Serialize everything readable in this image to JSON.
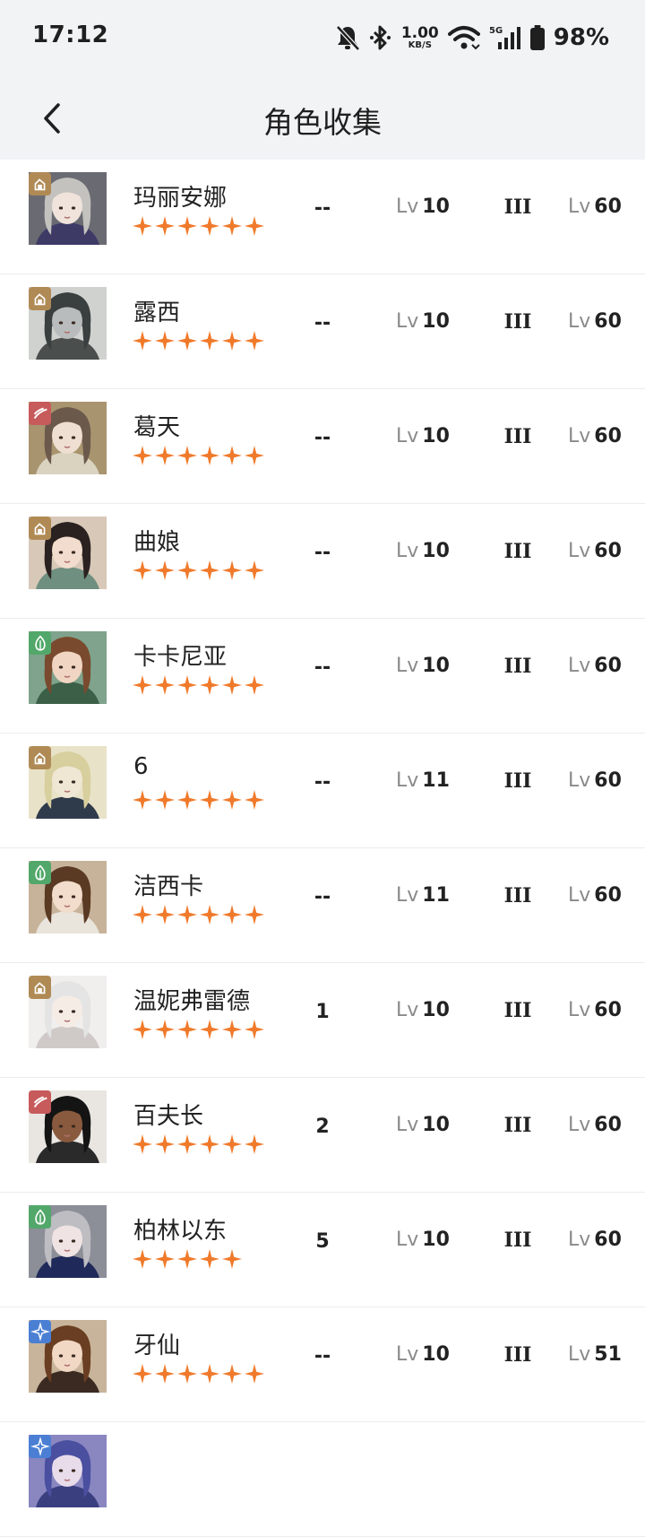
{
  "status_bar": {
    "time": "17:12",
    "net_speed_value": "1.00",
    "net_speed_unit": "KB/S",
    "network_type": "5G",
    "battery": "98%",
    "icons": [
      "mute-icon",
      "bluetooth-icon",
      "wifi-icon",
      "signal-icon",
      "battery-icon"
    ]
  },
  "header": {
    "title": "角色收集",
    "back_icon": "chevron-left-icon"
  },
  "colors": {
    "star": "#f07a2b",
    "gold": "#b08a55",
    "red": "#c75a5a",
    "green": "#52a86a",
    "blue": "#4a7fd4"
  },
  "characters": [
    {
      "name": "玛丽安娜",
      "stars": 6,
      "rank": "--",
      "level_label": "Lv",
      "level": "10",
      "tier": "III",
      "max_label": "Lv",
      "max_level": "60",
      "element": "gold",
      "portrait": {
        "hair": "#c4c2be",
        "skin": "#efe3dc",
        "cloth": "#3d3a66",
        "bg": "#6a6a72"
      }
    },
    {
      "name": "露西",
      "stars": 6,
      "rank": "--",
      "level_label": "Lv",
      "level": "10",
      "tier": "III",
      "max_label": "Lv",
      "max_level": "60",
      "element": "gold",
      "portrait": {
        "hair": "#3a3f3f",
        "skin": "#b9bcbc",
        "cloth": "#4a4f4e",
        "bg": "#cfd2cf"
      }
    },
    {
      "name": "葛天",
      "stars": 6,
      "rank": "--",
      "level_label": "Lv",
      "level": "10",
      "tier": "III",
      "max_label": "Lv",
      "max_level": "60",
      "element": "red",
      "portrait": {
        "hair": "#6b5a4c",
        "skin": "#efdfd2",
        "cloth": "#d9d3c0",
        "bg": "#a8946e"
      }
    },
    {
      "name": "曲娘",
      "stars": 6,
      "rank": "--",
      "level_label": "Lv",
      "level": "10",
      "tier": "III",
      "max_label": "Lv",
      "max_level": "60",
      "element": "gold",
      "portrait": {
        "hair": "#2a2221",
        "skin": "#f1dccd",
        "cloth": "#6f8f80",
        "bg": "#d8c8b8"
      }
    },
    {
      "name": "卡卡尼亚",
      "stars": 6,
      "rank": "--",
      "level_label": "Lv",
      "level": "10",
      "tier": "III",
      "max_label": "Lv",
      "max_level": "60",
      "element": "green",
      "portrait": {
        "hair": "#7a4a2e",
        "skin": "#f0d6c2",
        "cloth": "#3c5f48",
        "bg": "#7fa38c"
      }
    },
    {
      "name": "6",
      "stars": 6,
      "rank": "--",
      "level_label": "Lv",
      "level": "11",
      "tier": "III",
      "max_label": "Lv",
      "max_level": "60",
      "element": "gold",
      "portrait": {
        "hair": "#d8cf9e",
        "skin": "#efe7d4",
        "cloth": "#2f3a4a",
        "bg": "#e8e2c8"
      }
    },
    {
      "name": "洁西卡",
      "stars": 6,
      "rank": "--",
      "level_label": "Lv",
      "level": "11",
      "tier": "III",
      "max_label": "Lv",
      "max_level": "60",
      "element": "green",
      "portrait": {
        "hair": "#5a3a22",
        "skin": "#f2dccb",
        "cloth": "#e9e4dc",
        "bg": "#c7b39a"
      }
    },
    {
      "name": "温妮弗雷德",
      "stars": 6,
      "rank": "1",
      "level_label": "Lv",
      "level": "10",
      "tier": "III",
      "max_label": "Lv",
      "max_level": "60",
      "element": "gold",
      "portrait": {
        "hair": "#e4e4e4",
        "skin": "#f6ece6",
        "cloth": "#cfcac8",
        "bg": "#f1efee"
      }
    },
    {
      "name": "百夫长",
      "stars": 6,
      "rank": "2",
      "level_label": "Lv",
      "level": "10",
      "tier": "III",
      "max_label": "Lv",
      "max_level": "60",
      "element": "red",
      "portrait": {
        "hair": "#141414",
        "skin": "#8a5a3e",
        "cloth": "#2a2a2a",
        "bg": "#e9e6e2"
      }
    },
    {
      "name": "柏林以东",
      "stars": 5,
      "rank": "5",
      "level_label": "Lv",
      "level": "10",
      "tier": "III",
      "max_label": "Lv",
      "max_level": "60",
      "element": "green",
      "portrait": {
        "hair": "#bdbdc2",
        "skin": "#efe3e3",
        "cloth": "#1f2a5a",
        "bg": "#8c8f98"
      }
    },
    {
      "name": "牙仙",
      "stars": 6,
      "rank": "--",
      "level_label": "Lv",
      "level": "10",
      "tier": "III",
      "max_label": "Lv",
      "max_level": "51",
      "element": "blue",
      "portrait": {
        "hair": "#6a3e22",
        "skin": "#f1d8c4",
        "cloth": "#3a2a22",
        "bg": "#c8b49a"
      }
    },
    {
      "name": "",
      "stars": 0,
      "rank": "",
      "level_label": "",
      "level": "",
      "tier": "",
      "max_label": "",
      "max_level": "",
      "element": "blue",
      "portrait": {
        "hair": "#4a4fa0",
        "skin": "#e8dcea",
        "cloth": "#3a3f80",
        "bg": "#8a86c0"
      }
    }
  ]
}
